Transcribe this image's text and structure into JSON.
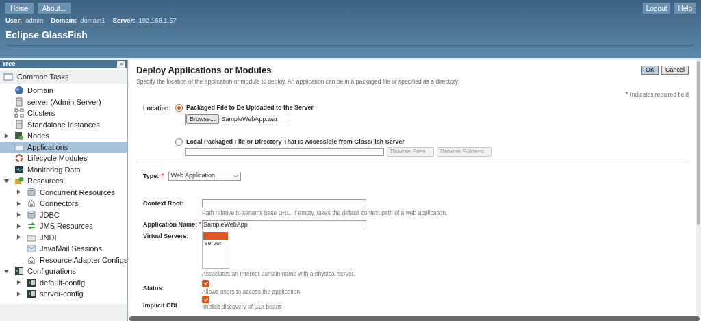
{
  "header": {
    "nav": [
      "Home",
      "About..."
    ],
    "actions": [
      "Logout",
      "Help"
    ],
    "info": [
      {
        "label": "User:",
        "value": "admin"
      },
      {
        "label": "Domain:",
        "value": "domain1"
      },
      {
        "label": "Server:",
        "value": "192.168.1.57"
      }
    ],
    "product": "Eclipse GlassFish"
  },
  "tree": {
    "title": "Tree",
    "collapse": "<",
    "top": {
      "label": "Common Tasks"
    },
    "items": [
      {
        "label": "Domain",
        "kind": "globe",
        "selected": false
      },
      {
        "label": "server (Admin Server)",
        "kind": "server",
        "selected": false
      },
      {
        "label": "Clusters",
        "kind": "cluster",
        "selected": false
      },
      {
        "label": "Standalone Instances",
        "kind": "server",
        "selected": false
      },
      {
        "label": "Nodes",
        "kind": "node",
        "selected": false,
        "expanded": false
      },
      {
        "label": "Applications",
        "kind": "window",
        "selected": true
      },
      {
        "label": "Lifecycle Modules",
        "kind": "cycle",
        "selected": false
      },
      {
        "label": "Monitoring Data",
        "kind": "monitor",
        "selected": false
      },
      {
        "label": "Resources",
        "kind": "resources",
        "selected": false,
        "expanded": true,
        "children": [
          {
            "label": "Concurrent Resources",
            "kind": "db",
            "selected": false,
            "expanded": false
          },
          {
            "label": "Connectors",
            "kind": "plug",
            "selected": false,
            "expanded": false
          },
          {
            "label": "JDBC",
            "kind": "db",
            "selected": false,
            "expanded": false
          },
          {
            "label": "JMS Resources",
            "kind": "arrows",
            "selected": false,
            "expanded": false
          },
          {
            "label": "JNDI",
            "kind": "folder",
            "selected": false,
            "expanded": false
          },
          {
            "label": "JavaMail Sessions",
            "kind": "mail",
            "selected": false
          },
          {
            "label": "Resource Adapter Configs",
            "kind": "plug",
            "selected": false
          }
        ]
      },
      {
        "label": "Configurations",
        "kind": "config",
        "selected": false,
        "expanded": true,
        "children": [
          {
            "label": "default-config",
            "kind": "config",
            "selected": false,
            "expanded": false
          },
          {
            "label": "server-config",
            "kind": "config",
            "selected": false,
            "expanded": false
          }
        ]
      }
    ]
  },
  "page": {
    "title": "Deploy Applications or Modules",
    "description": "Specify the location of the application or module to deploy. An application can be in a packaged file or specified as a directory.",
    "buttons": [
      "OK",
      "Cancel"
    ],
    "required_mark": "*",
    "required_note": "Indicates required field",
    "location": {
      "label": "Location:",
      "options": [
        {
          "label": "Packaged File to Be Uploaded to the Server",
          "selected": true,
          "browse": "Browse...",
          "file": "SampleWebApp.war"
        },
        {
          "label": "Local Packaged File or Directory That Is Accessible from GlassFish Server",
          "selected": false,
          "buttons": [
            {
              "label": "Browse Files...",
              "disabled": true
            },
            {
              "label": "Browse Folders...",
              "disabled": true
            }
          ]
        }
      ]
    },
    "type": {
      "label": "Type:",
      "value": "Web Application"
    },
    "context_root": {
      "label": "Context Root:",
      "hint": "Path relative to server's base URL. If empty, takes the default context path of a web application."
    },
    "app_name": {
      "label": "Application Name:",
      "value": "SampleWebApp"
    },
    "virtual_servers": {
      "label": "Virtual Servers:",
      "options": [
        {
          "selected": true
        },
        {
          "label": "server",
          "selected": false
        }
      ],
      "hint": "Associates an Internet domain name with a physical server."
    },
    "status": {
      "label": "Status:",
      "checked": true,
      "hint": "Allows users to access the application."
    },
    "implicit_cdi": {
      "label": "Implicit CDI",
      "checked": true,
      "hint": "Implicit discovery of CDI beans"
    }
  }
}
